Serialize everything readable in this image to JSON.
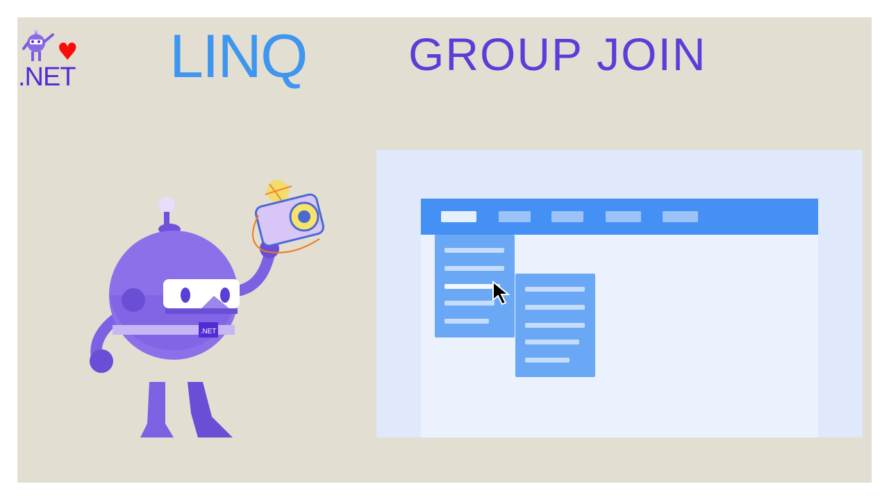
{
  "header": {
    "logo_text": ".NET",
    "title_left": "LINQ",
    "title_right": "GROUP JOIN"
  },
  "mascot": {
    "badge_text": ".NET"
  },
  "menubar": {
    "items": [
      {
        "name": "menu-item-1",
        "active": true
      },
      {
        "name": "menu-item-2",
        "active": false
      },
      {
        "name": "menu-item-3",
        "active": false
      },
      {
        "name": "menu-item-4",
        "active": false
      },
      {
        "name": "menu-item-5",
        "active": false
      }
    ]
  },
  "colors": {
    "background": "#e2ded2",
    "linq_title": "#3e96ee",
    "group_join_title": "#5a3ed8",
    "dotnet_purple": "#512bd4",
    "heart": "#ff0a0a",
    "menubar": "#4590f4",
    "dropdown": "#6aa8f6"
  },
  "icons": [
    "dotnet-bot-logo-icon",
    "heart-icon",
    "camera-icon",
    "mouse-pointer-icon"
  ]
}
